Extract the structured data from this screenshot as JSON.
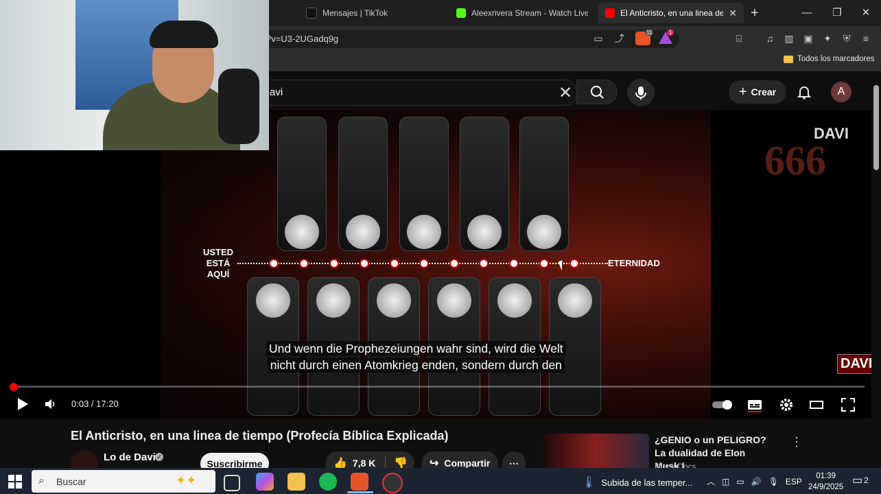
{
  "browser": {
    "tabs": [
      {
        "label": "Mensajes | TikTok",
        "icon": "tiktok-icon"
      },
      {
        "label": "Aleexrivera Stream - Watch Live ·",
        "icon": "kick-icon"
      },
      {
        "label": "El Anticristo, en una linea de t",
        "icon": "youtube-icon"
      }
    ],
    "new_tab": "+",
    "url_partial": "?v=U3-2UGadq9g",
    "bookmarks_label": "Todos los marcadores",
    "badges": {
      "brave_shield_count": "11",
      "rewards_count": "1"
    }
  },
  "youtube": {
    "search_value": "avi",
    "create_label": "Crear",
    "avatar_letter": "A"
  },
  "video": {
    "graphic": {
      "watermark_number": "666",
      "logo_text": "DAVI",
      "you_are_here": [
        "USTED",
        "ESTÁ",
        "AQUÍ"
      ],
      "end_label": "ETERNIDAD"
    },
    "subtitle_lines": [
      "Und wenn die Prophezeiungen wahr sind, wird die Welt",
      "nicht durch einen Atomkrieg enden, sondern durch den"
    ],
    "time_display": "0:03 / 17:20",
    "progress_fraction": 0.003,
    "title": "El Anticristo, en una linea de tiempo (Profecía Bíblica Explicada)",
    "channel": "Lo de Davi",
    "subscribe_label": "Suscribirme",
    "like_count": "7,8 K",
    "share_label": "Compartir"
  },
  "recommendation": {
    "title": "¿GENIO o un PELIGRO? La dualidad de Elon Musk | ...",
    "channel": "Dieck Docs"
  },
  "taskbar": {
    "search_placeholder": "Buscar",
    "weather_text": "Subida de las temper...",
    "language": "ESP",
    "time": "01:39",
    "date": "24/9/2025",
    "notification_count": "2"
  },
  "colors": {
    "youtube_red": "#ff0000",
    "taskbar_bg": "#1c2431",
    "chrome_bg": "#2d2d2d"
  }
}
